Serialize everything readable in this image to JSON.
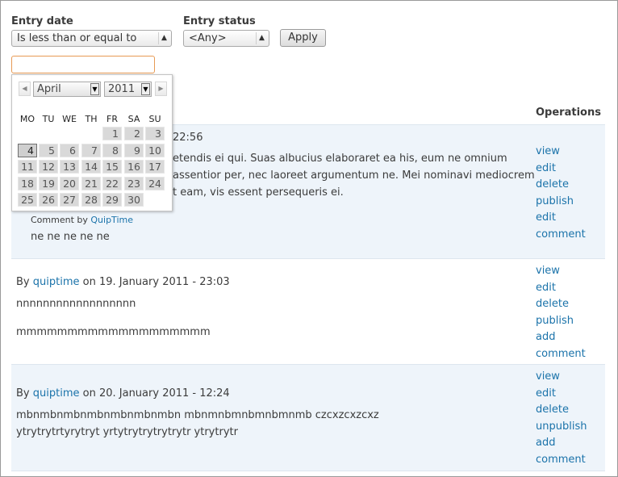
{
  "filters": {
    "entry_date_label": "Entry date",
    "entry_date_operator": "Is less than or equal to",
    "entry_status_label": "Entry status",
    "entry_status_value": "<Any>",
    "apply_label": "Apply",
    "date_value": "",
    "date_placeholder": ""
  },
  "calendar": {
    "prev_icon": "◀",
    "next_icon": "▶",
    "month": "April",
    "year": "2011",
    "weekdays": [
      "MO",
      "TU",
      "WE",
      "TH",
      "FR",
      "SA",
      "SU"
    ],
    "weeks": [
      [
        "",
        "",
        "",
        "",
        "1",
        "2",
        "3"
      ],
      [
        "4",
        "5",
        "6",
        "7",
        "8",
        "9",
        "10"
      ],
      [
        "11",
        "12",
        "13",
        "14",
        "15",
        "16",
        "17"
      ],
      [
        "18",
        "19",
        "20",
        "21",
        "22",
        "23",
        "24"
      ],
      [
        "25",
        "26",
        "27",
        "28",
        "29",
        "30",
        ""
      ]
    ],
    "today": "4"
  },
  "table": {
    "operations_header": "Operations"
  },
  "rows": [
    {
      "time_fragment": "22:56",
      "lines": [
        "etendis ei qui. Suas albucius elaboraret ea his, eum ne omnium",
        "assentior per, nec laoreet argumentum ne. Mei nominavi mediocrem",
        "t eam, vis essent persequeris ei."
      ],
      "comment_by_label": "Comment by",
      "comment_author": "QuipTime",
      "comment_text": "ne ne ne ne ne",
      "ops": [
        "view",
        "edit",
        "delete",
        "publish",
        "edit",
        "comment"
      ]
    },
    {
      "by_label": "By",
      "author": "quiptime",
      "date_text": "on 19. January 2011 - 23:03",
      "lines": [
        "nnnnnnnnnnnnnnnnnn",
        "mmmmmmmmmmmmmmmmmmm"
      ],
      "ops": [
        "view",
        "edit",
        "delete",
        "publish",
        "add",
        "comment"
      ]
    },
    {
      "by_label": "By",
      "author": "quiptime",
      "date_text": "on 20. January 2011 - 12:24",
      "lines": [
        "mbnmbnmbnmbnmbnmbnmbn mbnmnbmnbmnbmnmb czcxzcxzcxz",
        "ytrytrytrtyrytryt yrtytrytrytrytrytr ytrytrytr"
      ],
      "ops": [
        "view",
        "edit",
        "delete",
        "unpublish",
        "add",
        "comment"
      ]
    }
  ]
}
